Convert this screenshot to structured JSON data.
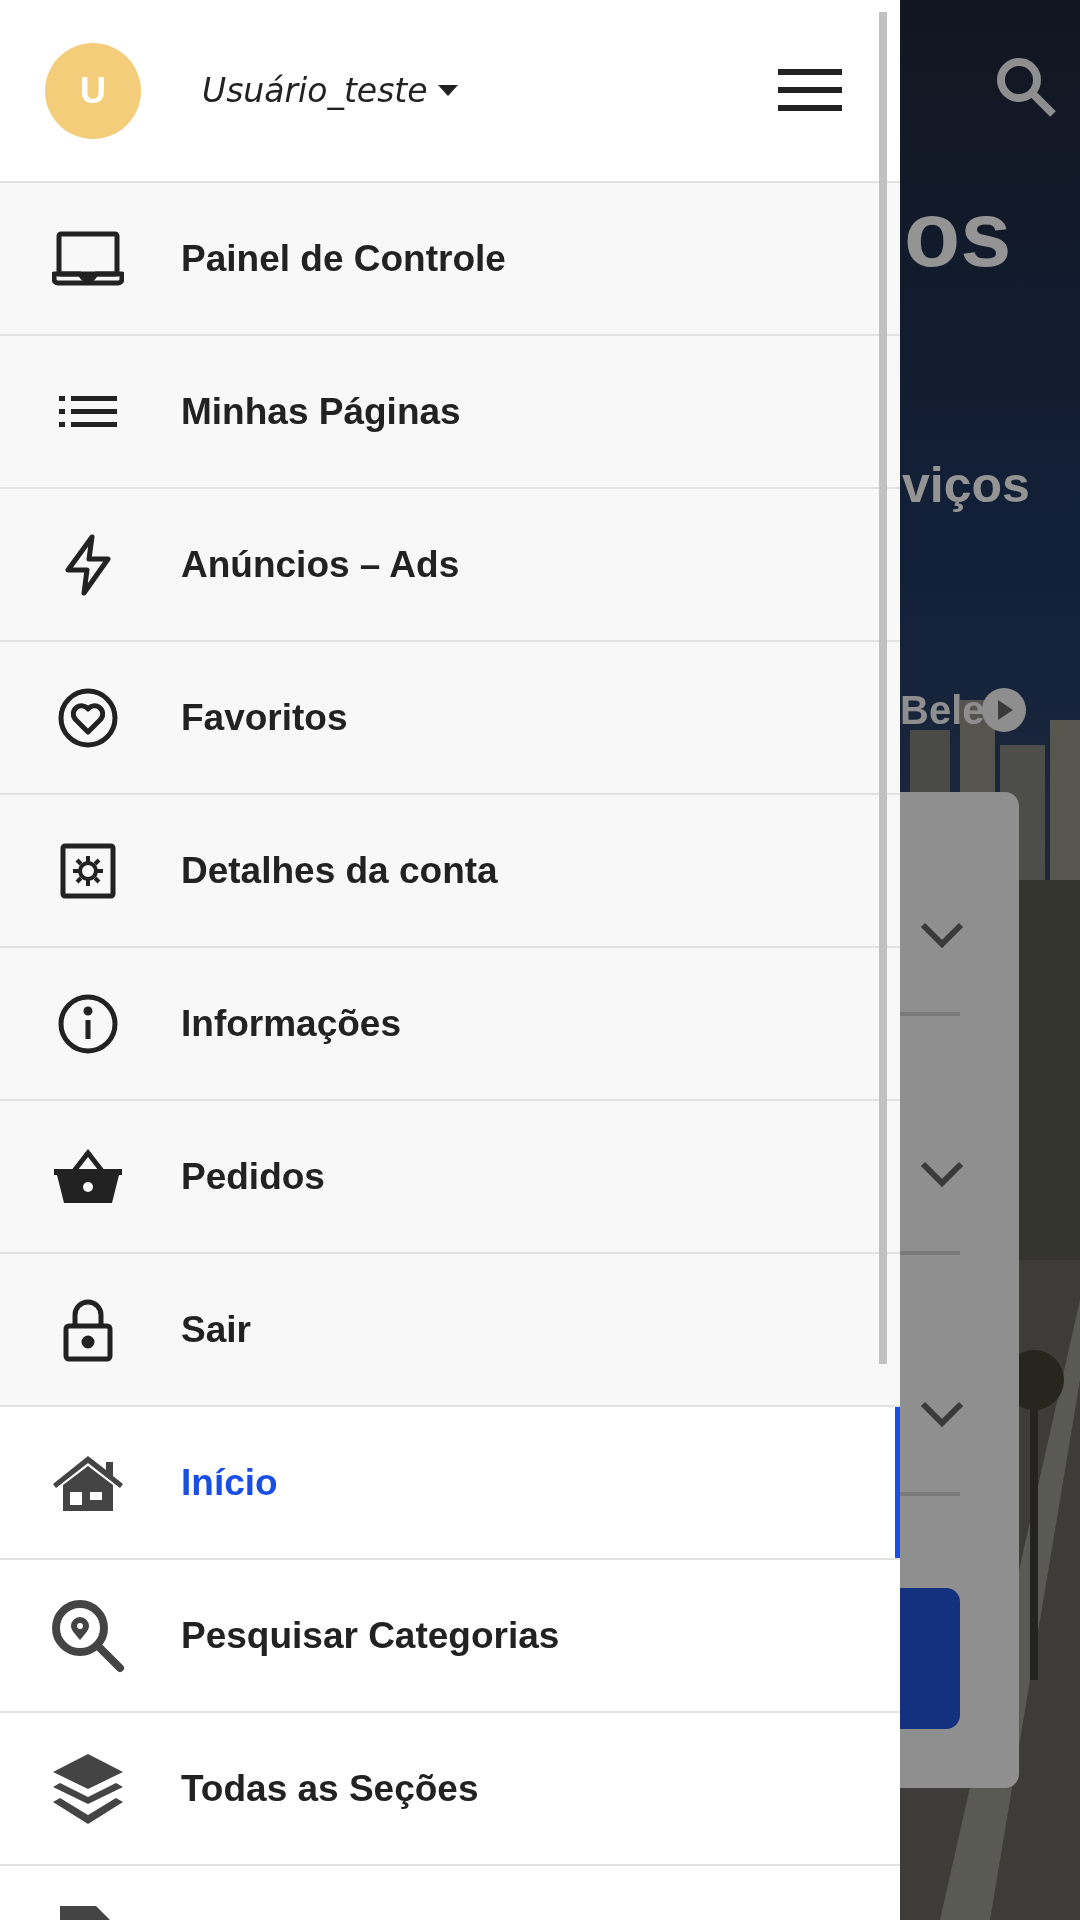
{
  "drawer": {
    "avatar_letter": "U",
    "username": "Usuário_teste",
    "account_menu": [
      {
        "label": "Painel de Controle",
        "selected": false
      },
      {
        "label": "Minhas Páginas",
        "selected": false
      },
      {
        "label": "Anúncios – Ads",
        "selected": false
      },
      {
        "label": "Favoritos",
        "selected": false
      },
      {
        "label": "Detalhes da conta",
        "selected": false
      },
      {
        "label": "Informações",
        "selected": false
      },
      {
        "label": "Pedidos",
        "selected": false
      },
      {
        "label": "Sair",
        "selected": false
      }
    ],
    "main_menu": [
      {
        "label": "Início",
        "selected": true
      },
      {
        "label": "Pesquisar Categorias",
        "selected": false
      },
      {
        "label": "Todas as Seções",
        "selected": false
      }
    ]
  },
  "background_page": {
    "heading_fragment": "os",
    "subtitle_fragment": "viços",
    "location_fragment": "Bele"
  }
}
